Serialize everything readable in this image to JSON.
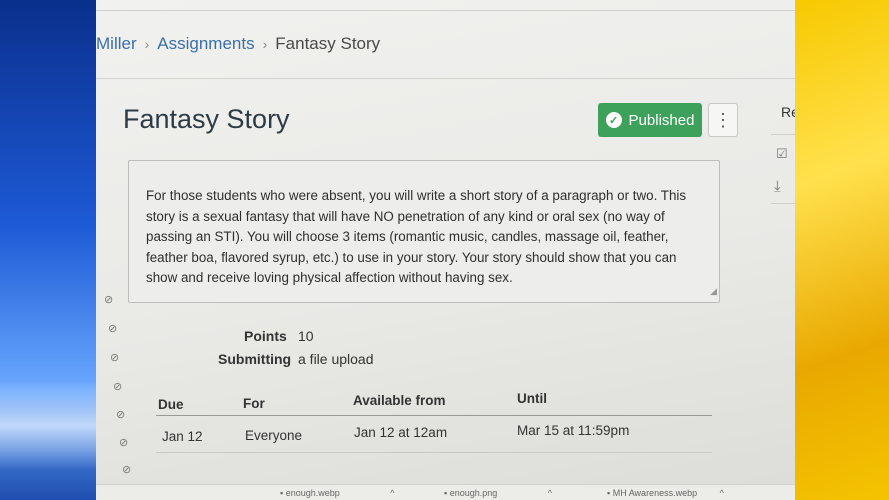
{
  "breadcrumb": {
    "course": "Miller",
    "section": "Assignments",
    "current": "Fantasy Story",
    "separator": "›"
  },
  "header": {
    "title": "Fantasy Story",
    "published_label": "Published",
    "published_icon": "check-circle-icon",
    "more_icon": "kebab-menu-icon",
    "accent_color": "#2f9a4f"
  },
  "sidebar_right": {
    "label": "Re"
  },
  "description": "For those students who were absent, you will write a short story of a paragraph or two. This story is a sexual fantasy that will have NO penetration of any kind or oral sex (no way of passing an STI). You will choose 3 items (romantic music, candles, massage oil, feather, feather boa, flavored syrup, etc.) to use in your story. Your story should show that you can show and receive loving physical affection without having sex.",
  "details": {
    "points_label": "Points",
    "points_value": "10",
    "submitting_label": "Submitting",
    "submitting_value": "a file upload"
  },
  "dates_table": {
    "headers": [
      "Due",
      "For",
      "Available from",
      "Until"
    ],
    "rows": [
      [
        "Jan 12",
        "Everyone",
        "Jan 12 at 12am",
        "Mar 15 at 11:59pm"
      ]
    ]
  },
  "downloads": [
    {
      "name": "enough.webp"
    },
    {
      "name": "enough.png"
    },
    {
      "name": "MH Awareness.webp"
    }
  ]
}
